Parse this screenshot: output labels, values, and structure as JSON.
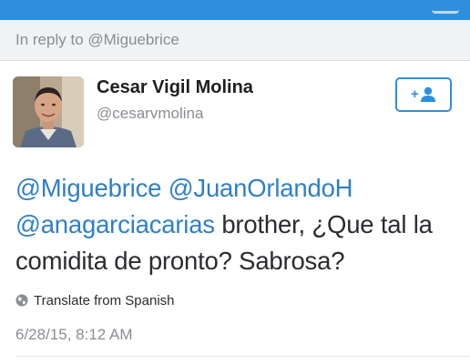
{
  "reply_context": "In reply to @Miguebrice",
  "user": {
    "name": "Cesar Vigil Molina",
    "handle": "@cesarvmolina"
  },
  "follow_button": {
    "icon": "add-person-icon",
    "glyph": "+"
  },
  "tweet": {
    "mentions": [
      "@Miguebrice",
      "@JuanOrlandoH",
      "@anagarciacarias"
    ],
    "text": "brother, ¿Que tal la comidita de pronto?  Sabrosa?"
  },
  "translate": {
    "icon": "globe-icon",
    "label": "Translate from Spanish"
  },
  "timestamp": "6/28/15, 8:12 AM",
  "colors": {
    "accent": "#2f8fde",
    "mention": "#2f7fc8",
    "muted": "#8a8d92",
    "text": "#2a2c30"
  }
}
